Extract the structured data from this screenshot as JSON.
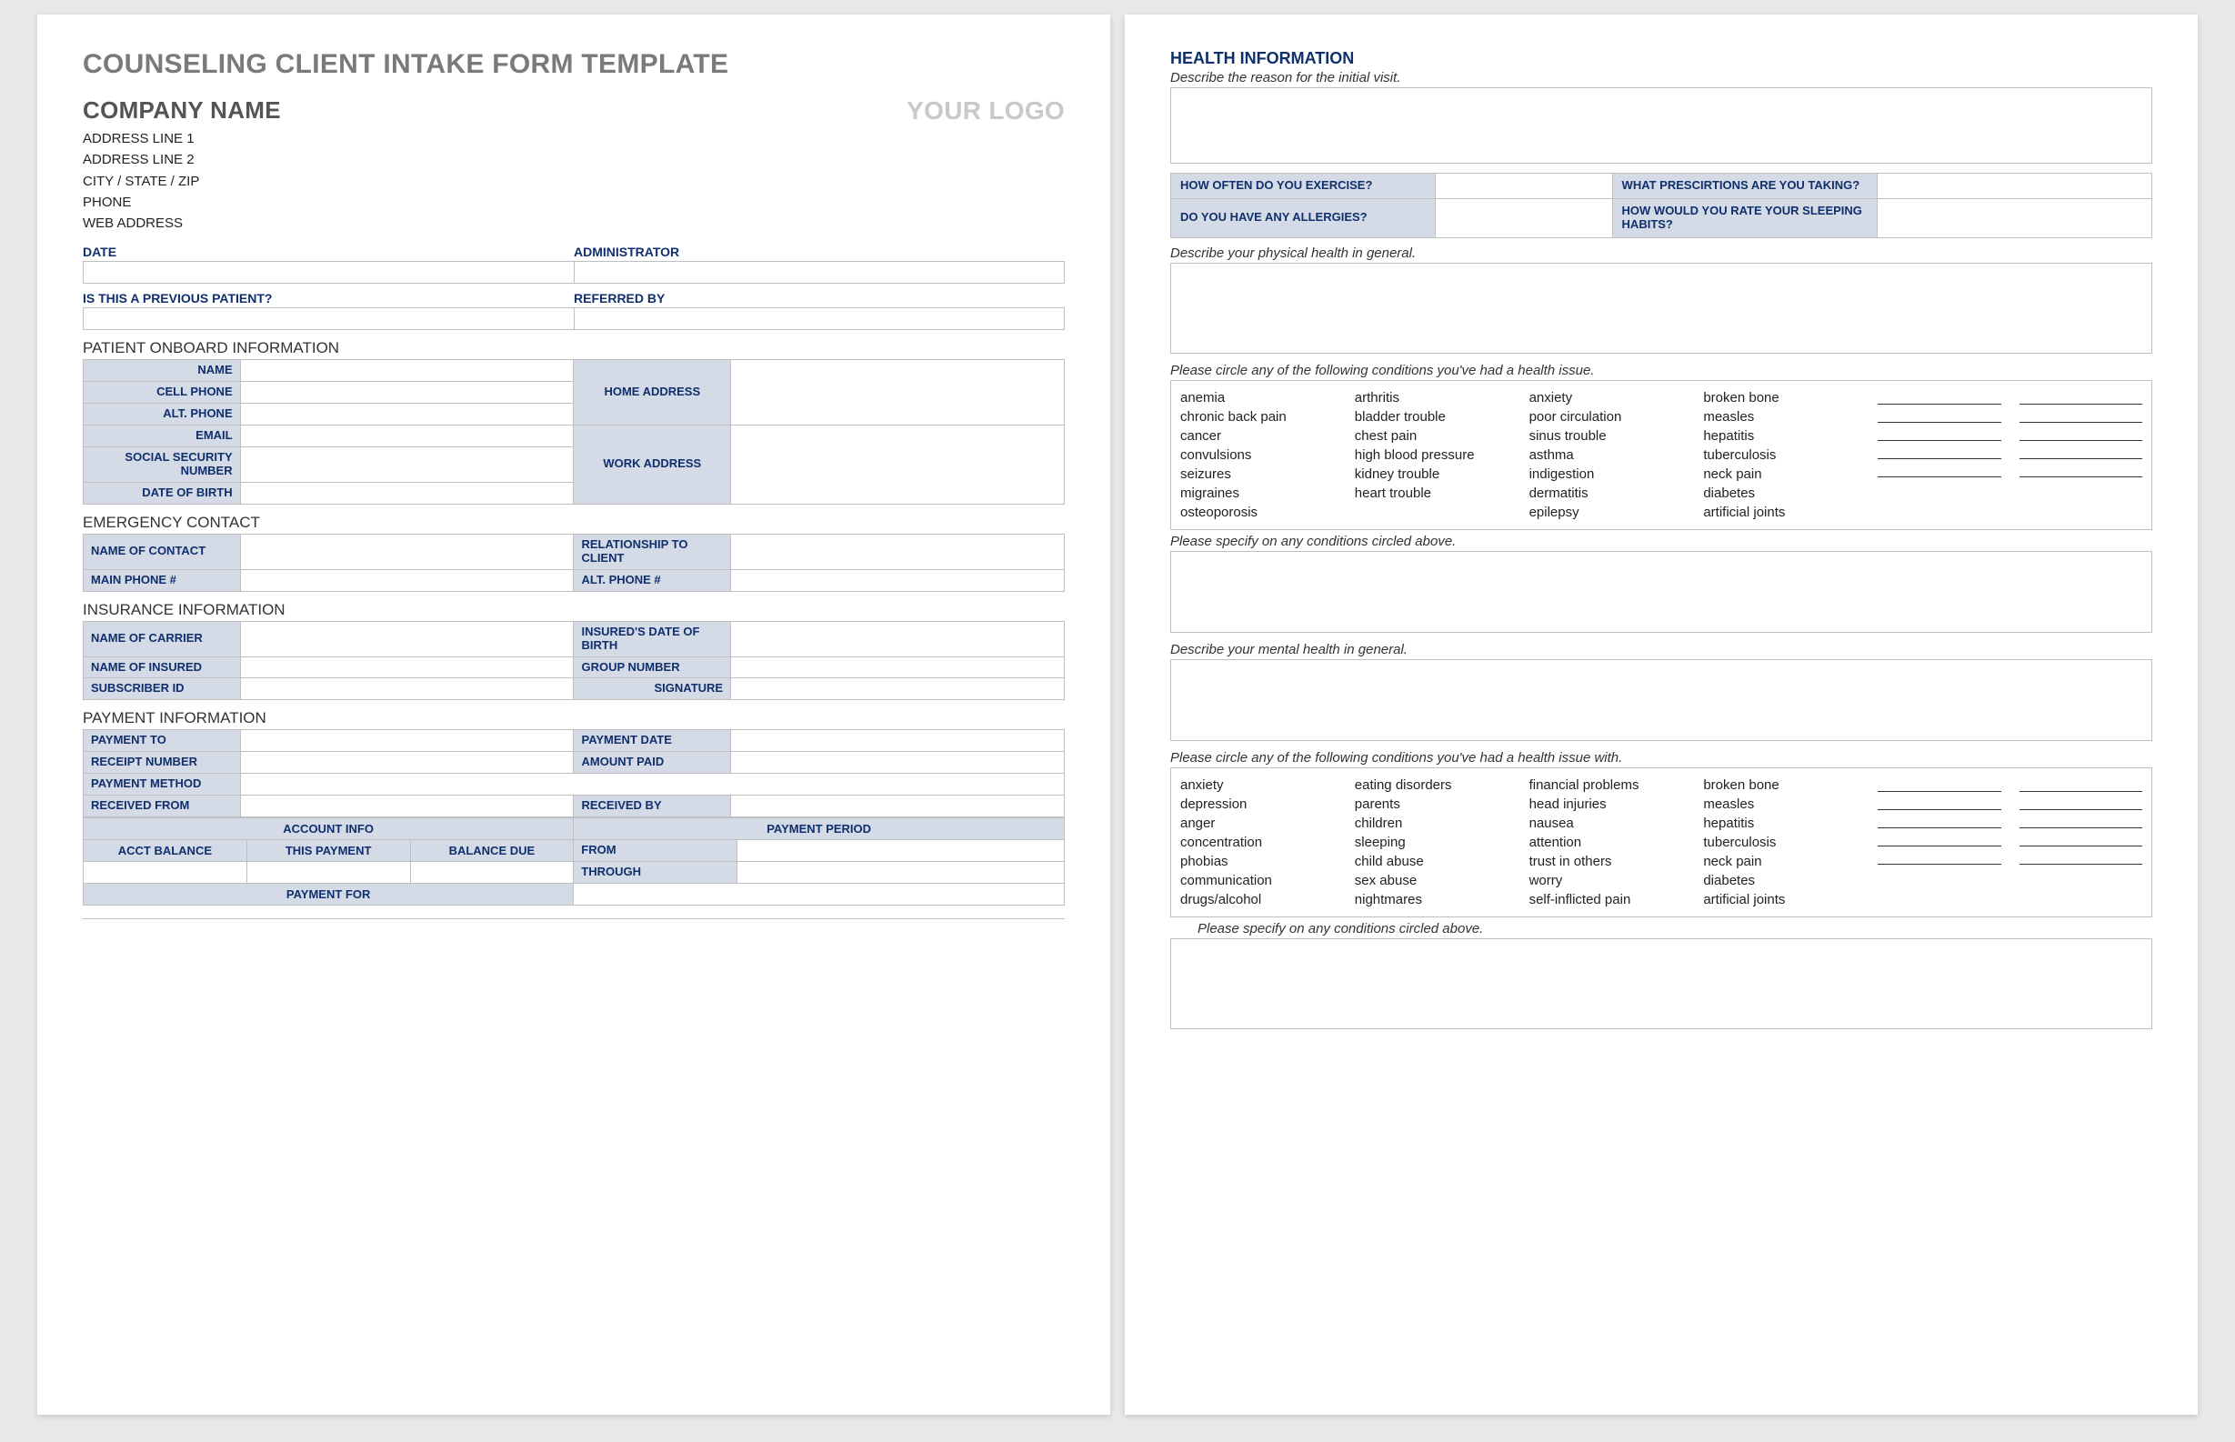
{
  "page1": {
    "title": "COUNSELING CLIENT INTAKE FORM TEMPLATE",
    "company": "COMPANY NAME",
    "addr1": "ADDRESS LINE 1",
    "addr2": "ADDRESS LINE 2",
    "addr3": "CITY / STATE / ZIP",
    "phone": "PHONE",
    "web": "WEB ADDRESS",
    "logo": "YOUR LOGO",
    "date": "DATE",
    "admin": "ADMINISTRATOR",
    "prev": "IS THIS A PREVIOUS PATIENT?",
    "ref": "REFERRED BY",
    "sec_onboard": "PATIENT ONBOARD INFORMATION",
    "name": "NAME",
    "cell": "CELL PHONE",
    "alt": "ALT. PHONE",
    "email": "EMAIL",
    "ssn": "SOCIAL SECURITY NUMBER",
    "dob": "DATE OF BIRTH",
    "homeaddr": "HOME ADDRESS",
    "workaddr": "WORK ADDRESS",
    "sec_emerg": "EMERGENCY CONTACT",
    "ec_name": "NAME OF CONTACT",
    "ec_rel": "RELATIONSHIP TO CLIENT",
    "ec_main": "MAIN PHONE #",
    "ec_alt": "ALT. PHONE #",
    "sec_ins": "INSURANCE INFORMATION",
    "ins_carrier": "NAME OF CARRIER",
    "ins_dob": "INSURED'S DATE OF BIRTH",
    "ins_name": "NAME OF INSURED",
    "ins_group": "GROUP NUMBER",
    "ins_sub": "SUBSCRIBER ID",
    "ins_sig": "SIGNATURE",
    "sec_pay": "PAYMENT INFORMATION",
    "pay_to": "PAYMENT TO",
    "pay_date": "PAYMENT DATE",
    "receipt": "RECEIPT NUMBER",
    "amount": "AMOUNT PAID",
    "method": "PAYMENT METHOD",
    "recv_from": "RECEIVED FROM",
    "recv_by": "RECEIVED BY",
    "acct_info": "ACCOUNT INFO",
    "pay_period": "PAYMENT PERIOD",
    "acct_bal": "ACCT BALANCE",
    "this_pay": "THIS PAYMENT",
    "bal_due": "BALANCE DUE",
    "from": "FROM",
    "through": "THROUGH",
    "pay_for": "PAYMENT FOR"
  },
  "page2": {
    "title": "HEALTH INFORMATION",
    "q_reason": "Describe the reason for the initial visit.",
    "exercise": "HOW OFTEN DO YOU EXERCISE?",
    "rx": "WHAT PRESCIRTIONS ARE YOU TAKING?",
    "allergies": "DO YOU HAVE ANY ALLERGIES?",
    "sleep": "HOW WOULD YOU RATE YOUR SLEEPING HABITS?",
    "phys": "Describe your physical health in general.",
    "circle1": "Please circle any of the following conditions you've had a health issue.",
    "c1a": "anemia\nchronic back pain\ncancer\nconvulsions\nseizures\nmigraines\nosteoporosis",
    "c1b": "arthritis\nbladder trouble\nchest pain\nhigh blood pressure\nkidney trouble\nheart trouble",
    "c1c": "anxiety\npoor circulation\nsinus trouble\nasthma\nindigestion\ndermatitis\nepilepsy",
    "c1d": "broken bone\nmeasles\nhepatitis\ntuberculosis\nneck pain\ndiabetes\nartificial joints",
    "spec1": "Please specify on any conditions circled above.",
    "mental": "Describe your mental health in general.",
    "circle2": "Please circle any of the following conditions you've had a health issue with.",
    "c2a": "anxiety\ndepression\nanger\nconcentration\nphobias\ncommunication\ndrugs/alcohol",
    "c2b": "eating disorders\nparents\nchildren\nsleeping\nchild abuse\nsex abuse\nnightmares",
    "c2c": "financial problems\nhead injuries\nnausea\nattention\ntrust in others\nworry\nself-inflicted pain",
    "c2d": "broken bone\nmeasles\nhepatitis\ntuberculosis\nneck pain\ndiabetes\nartificial joints",
    "spec2": "Please specify on any conditions circled above."
  }
}
